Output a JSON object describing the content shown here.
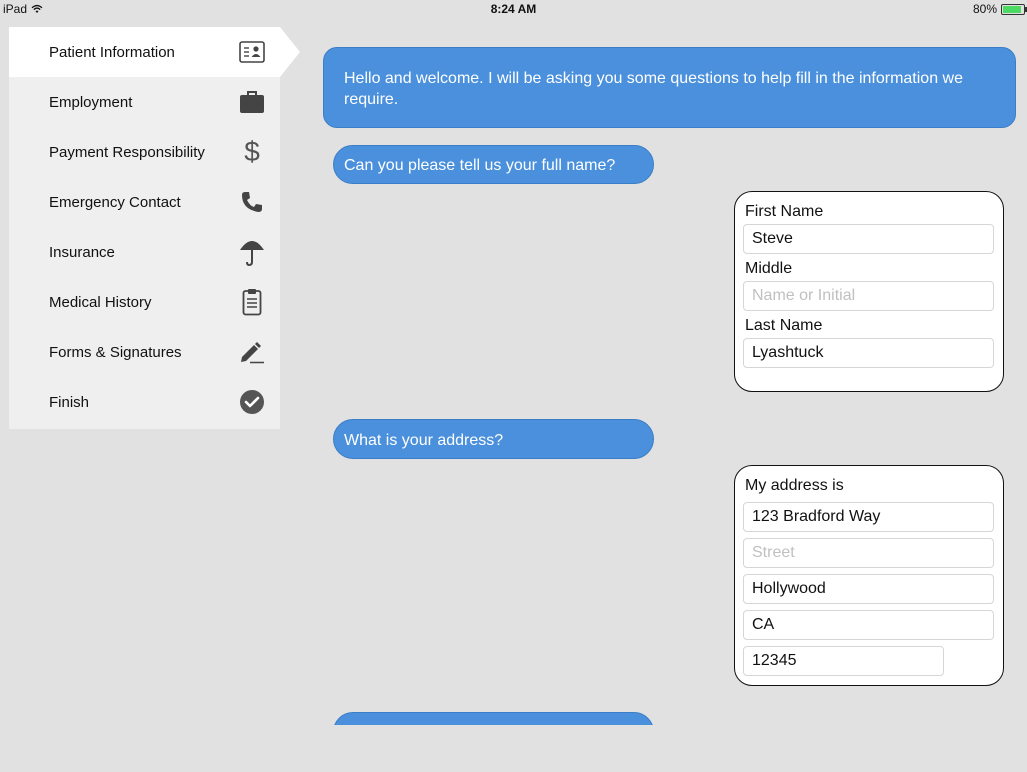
{
  "status_bar": {
    "device": "iPad",
    "time": "8:24 AM",
    "battery": "80%"
  },
  "sidebar": {
    "items": [
      {
        "label": "Patient Information",
        "icon": "id-card-icon",
        "active": true
      },
      {
        "label": "Employment",
        "icon": "briefcase-icon"
      },
      {
        "label": "Payment Responsibility",
        "icon": "dollar-icon"
      },
      {
        "label": "Emergency Contact",
        "icon": "phone-icon"
      },
      {
        "label": "Insurance",
        "icon": "umbrella-icon"
      },
      {
        "label": "Medical History",
        "icon": "clipboard-icon"
      },
      {
        "label": "Forms & Signatures",
        "icon": "pen-icon"
      },
      {
        "label": "Finish",
        "icon": "checkmark-icon"
      }
    ]
  },
  "chat": {
    "welcome": "Hello and welcome.  I will be asking you some questions to help fill in the information we require.",
    "q_name": "Can you please tell us your full name?",
    "q_address": "What is your address?"
  },
  "name_form": {
    "first_label": "First Name",
    "first_value": "Steve",
    "middle_label": "Middle",
    "middle_placeholder": "Name or Initial",
    "last_label": "Last Name",
    "last_value": "Lyashtuck"
  },
  "address_form": {
    "label": "My address is",
    "line1_value": "123 Bradford Way",
    "line2_placeholder": "Street",
    "city_value": "Hollywood",
    "state_value": "CA",
    "zip_value": "12345"
  },
  "colors": {
    "bubble": "#4a90dc",
    "background": "#e1e1e1",
    "sidebar": "#efefef"
  }
}
